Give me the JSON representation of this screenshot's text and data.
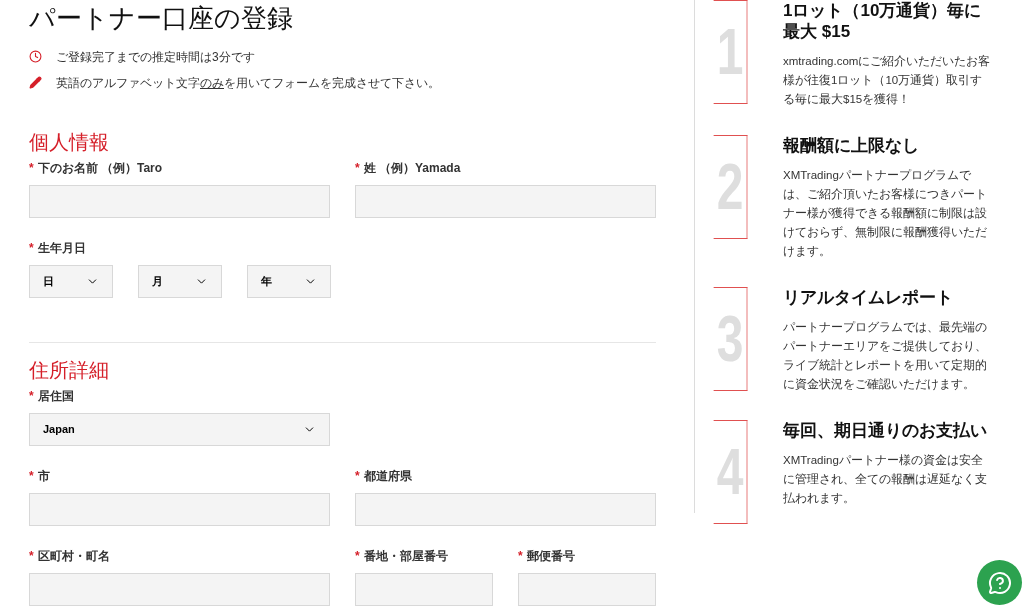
{
  "title": "パートナー口座の登録",
  "notices": [
    {
      "kind": "time",
      "text": "ご登録完了までの推定時間は3分です"
    },
    {
      "kind": "edit",
      "text": "英語のアルファベット文字",
      "underlined": "のみ",
      "text_after": "を用いてフォームを完成させて下さい。"
    }
  ],
  "sections": [
    {
      "heading": "個人情報",
      "rows": [
        {
          "kind": "pair",
          "fields": [
            {
              "kind": "text",
              "mark": "*",
              "label": "下のお名前 （例）Taro"
            },
            {
              "kind": "text",
              "mark": "*",
              "label": "姓 （例）Yamada"
            }
          ]
        },
        {
          "kind": "dates",
          "label": "生年月日",
          "mark": "*",
          "fields": [
            {
              "kind": "select",
              "value": "日"
            },
            {
              "kind": "select",
              "value": "月"
            },
            {
              "kind": "select",
              "value": "年"
            }
          ]
        }
      ]
    },
    {
      "heading": "住所詳細",
      "rows": [
        {
          "kind": "pair",
          "fields": [
            {
              "kind": "select",
              "mark": "*",
              "label": "居住国",
              "value": "Japan"
            }
          ]
        },
        {
          "kind": "pair",
          "fields": [
            {
              "kind": "text",
              "mark": "*",
              "label": "市"
            },
            {
              "kind": "text",
              "mark": "*",
              "label": "都道府県"
            }
          ]
        },
        {
          "kind": "triple",
          "fields": [
            {
              "kind": "text",
              "mark": "*",
              "label": "区町村・町名"
            },
            {
              "kind": "text",
              "mark": "*",
              "label": "番地・部屋番号"
            },
            {
              "kind": "text",
              "mark": "*",
              "label": "郵便番号"
            }
          ]
        }
      ]
    }
  ],
  "benefits": [
    {
      "number": "1",
      "title": "1ロット（10万通貨）毎に最大 $15",
      "text": "xmtrading.comにご紹介いただいたお客様が往復1ロット（10万通貨）取引する毎に最大$15を獲得！"
    },
    {
      "number": "2",
      "title": "報酬額に上限なし",
      "text": "XMTradingパートナープログラムでは、ご紹介頂いたお客様につきパートナー様が獲得できる報酬額に制限は設けておらず、無制限に報酬獲得いただけます。"
    },
    {
      "number": "3",
      "title": "リアルタイムレポート",
      "text": "パートナープログラムでは、最先端のパートナーエリアをご提供しており、ライブ統計とレポートを用いて定期的に資金状況をご確認いただけます。"
    },
    {
      "number": "4",
      "title": "毎回、期日通りのお支払い",
      "text": "XMTradingパートナー様の資金は安全に管理され、全ての報酬は遅延なく支払われます。"
    }
  ]
}
